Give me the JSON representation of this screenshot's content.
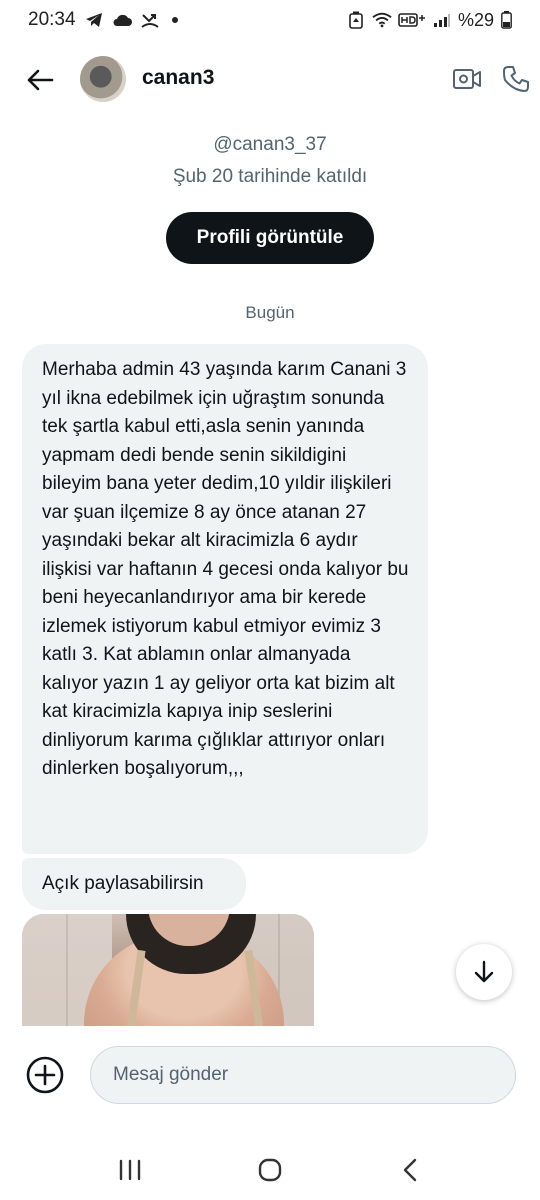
{
  "status_bar": {
    "time": "20:34",
    "battery": "%29"
  },
  "header": {
    "name": "canan3"
  },
  "profile": {
    "handle": "@canan3_37",
    "joined": "Şub 20 tarihinde katıldı",
    "view_profile_label": "Profili görüntüle"
  },
  "date_separator": "Bugün",
  "messages": [
    {
      "text": "Merhaba admin 43 yaşında karım Canani 3 yıl ikna edebilmek için uğraştım sonunda tek şartla kabul etti,asla senin yanında yapmam dedi bende senin sikildigini bileyim bana yeter dedim,10 yıldir ilişkileri var şuan ilçemize 8 ay önce atanan 27 yaşındaki bekar alt kiracimizla 6 aydır ilişkisi var haftanın 4 gecesi onda kalıyor bu beni heyecanlandırıyor ama bir kerede izlemek istiyorum kabul etmiyor evimiz 3 katlı 3. Kat ablamın onlar almanyada kalıyor yazın 1 ay geliyor  orta kat bizim alt kat kiracimizla kapıya inip seslerini dinliyorum karıma çığlıklar attırıyor onları dinlerken boşalıyorum,,,"
    },
    {
      "text": "Açık paylasabilirsin"
    }
  ],
  "composer": {
    "placeholder": "Mesaj gönder"
  },
  "icons": {
    "back": "arrow-left-icon",
    "video": "video-camera-icon",
    "call": "phone-icon",
    "scroll": "arrow-down-icon",
    "add": "plus-circle-icon"
  }
}
